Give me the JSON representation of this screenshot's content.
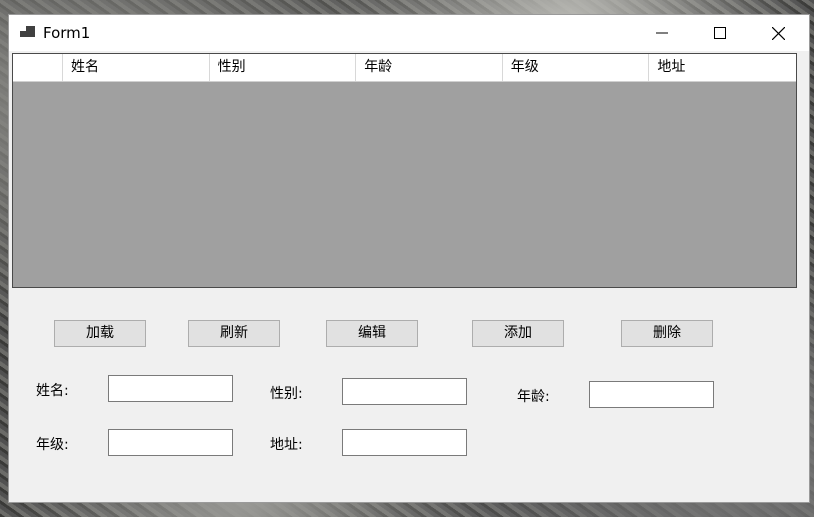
{
  "window": {
    "title": "Form1"
  },
  "grid": {
    "columns": [
      "姓名",
      "性别",
      "年龄",
      "年级",
      "地址"
    ]
  },
  "buttons": {
    "load": "加载",
    "refresh": "刷新",
    "edit": "编辑",
    "add": "添加",
    "delete": "删除"
  },
  "fields": {
    "name": {
      "label": "姓名:",
      "value": ""
    },
    "gender": {
      "label": "性别:",
      "value": ""
    },
    "age": {
      "label": "年龄:",
      "value": ""
    },
    "grade": {
      "label": "年级:",
      "value": ""
    },
    "address": {
      "label": "地址:",
      "value": ""
    }
  },
  "icons": {
    "app": "form-app-icon",
    "minimize": "minimize-icon",
    "maximize": "maximize-icon",
    "close": "close-icon"
  }
}
